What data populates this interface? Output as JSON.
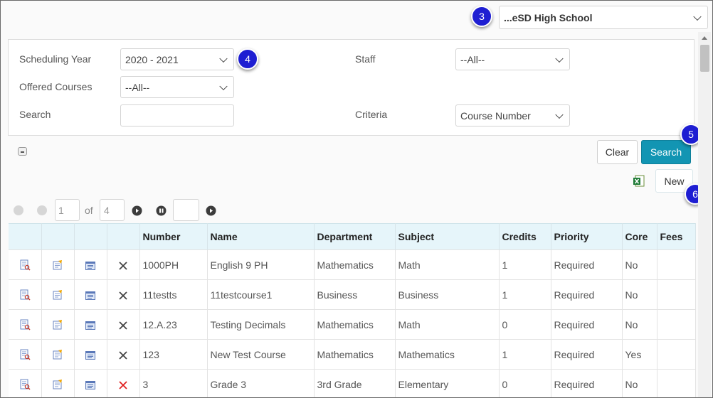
{
  "school_select": {
    "value": "...eSD High School"
  },
  "callouts": {
    "n3": "3",
    "n4": "4",
    "n5": "5",
    "n6": "6"
  },
  "filters": {
    "scheduling_year_label": "Scheduling Year",
    "scheduling_year_value": "2020 - 2021",
    "offered_courses_label": "Offered Courses",
    "offered_courses_value": "--All--",
    "search_label": "Search",
    "search_value": "",
    "staff_label": "Staff",
    "staff_value": "--All--",
    "criteria_label": "Criteria",
    "criteria_value": "Course Number"
  },
  "actions": {
    "clear_label": "Clear",
    "search_label": "Search",
    "new_label": "New"
  },
  "pager": {
    "page": "1",
    "of_label": "of",
    "total": "4",
    "goto": ""
  },
  "table": {
    "headers": [
      "",
      "",
      "",
      "",
      "Number",
      "Name",
      "Department",
      "Subject",
      "Credits",
      "Priority",
      "Core",
      "Fees"
    ],
    "rows": [
      {
        "number": "1000PH",
        "name": "English 9 PH",
        "department": "Mathematics",
        "subject": "Math",
        "credits": "1",
        "priority": "Required",
        "core": "No",
        "fees": "",
        "delete_active": false
      },
      {
        "number": "11testts",
        "name": "11testcourse1",
        "department": "Business",
        "subject": "Business",
        "credits": "1",
        "priority": "Required",
        "core": "No",
        "fees": "",
        "delete_active": false
      },
      {
        "number": "12.A.23",
        "name": "Testing Decimals",
        "department": "Mathematics",
        "subject": "Math",
        "credits": "0",
        "priority": "Required",
        "core": "No",
        "fees": "",
        "delete_active": false
      },
      {
        "number": "123",
        "name": "New Test Course",
        "department": "Mathematics",
        "subject": "Mathematics",
        "credits": "1",
        "priority": "Required",
        "core": "Yes",
        "fees": "",
        "delete_active": false
      },
      {
        "number": "3",
        "name": "Grade 3",
        "department": "3rd Grade",
        "subject": "Elementary",
        "credits": "0",
        "priority": "Required",
        "core": "No",
        "fees": "",
        "delete_active": true
      }
    ]
  },
  "colors": {
    "search_button": "#1295b3",
    "callout": "#1e1ed2",
    "header_bg": "#e6f5fa",
    "delete_active": "#e02020"
  }
}
